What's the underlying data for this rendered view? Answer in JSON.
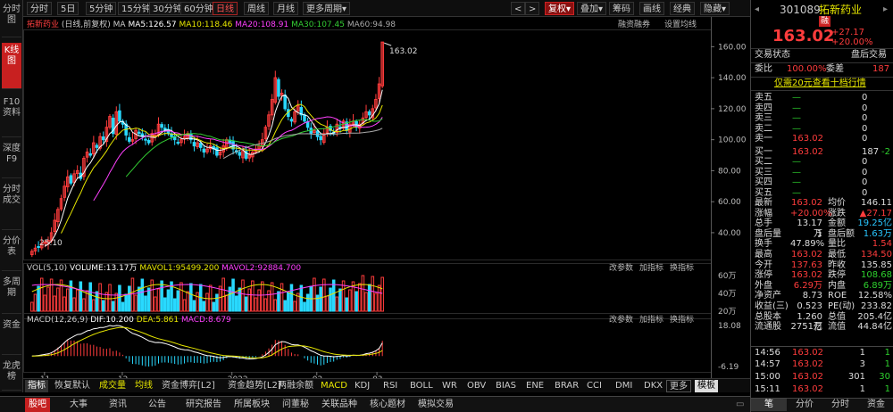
{
  "left_nav": [
    "分时图",
    "K线图",
    "F10资料",
    "深度F9",
    "分时成交",
    "分价表",
    "多周期",
    "资金",
    "龙虎榜"
  ],
  "left_nav_active": 1,
  "toolbar": {
    "periods": [
      "分时",
      "5日",
      "5分钟",
      "15分钟",
      "30分钟",
      "60分钟",
      "日线",
      "周线",
      "月线",
      "更多周期"
    ],
    "active_period": "日线",
    "right": [
      "复权",
      "叠加",
      "筹码",
      "画线",
      "经典",
      "隐藏"
    ],
    "dropdown_mark": "▾",
    "nav_arrows": [
      "<",
      ">"
    ]
  },
  "chart": {
    "stock_name": "拓新药业",
    "mode": "(日线,前复权)",
    "ma_label": "MA",
    "ma": [
      {
        "label": "MA5:126.57",
        "color": "#ffffff"
      },
      {
        "label": "MA10:118.46",
        "color": "#e6e600"
      },
      {
        "label": "MA20:108.91",
        "color": "#ff40ff"
      },
      {
        "label": "MA30:107.45",
        "color": "#33cc33"
      },
      {
        "label": "MA60:94.98",
        "color": "#aaaaaa"
      }
    ],
    "top_right": [
      "融资融券",
      "设置均线"
    ],
    "high_label": "163.02",
    "low_label": "25.10",
    "price_ticks": [
      "160.00",
      "140.00",
      "120.00",
      "100.00",
      "80.00",
      "60.00",
      "40.00"
    ],
    "date_ticks": [
      "11",
      "12",
      "2022",
      "02",
      "03"
    ],
    "vol_legend": {
      "name": "VOL(5,10)",
      "vol": "VOLUME:13.17万",
      "mavol1": "MAVOL1:95499.200",
      "mavol2": "MAVOL2:92884.700"
    },
    "vol_ticks": [
      "60万",
      "40万",
      "20万"
    ],
    "macd_legend": {
      "name": "MACD(12,26,9)",
      "dif": "DIF:10.200",
      "dea": "DEA:5.861",
      "macd": "MACD:8.679"
    },
    "macd_ticks": [
      "18.08",
      "-6.19"
    ],
    "panel_buttons": [
      "改参数",
      "加指标",
      "换指标"
    ],
    "colors": {
      "up": "#ff3c3c",
      "down": "#29d9ff",
      "ma5": "#ffffff",
      "ma10": "#e6e600",
      "ma20": "#ff40ff",
      "ma30": "#33cc33",
      "ma60": "#aaaaaa"
    }
  },
  "chart_data": {
    "type": "candlestick",
    "ylim": [
      25,
      170
    ],
    "dates": [
      "11",
      "12",
      "2022",
      "02",
      "03"
    ],
    "close": [
      28,
      30,
      31,
      33,
      34,
      35,
      40,
      48,
      55,
      62,
      70,
      76,
      72,
      78,
      80,
      75,
      88,
      92,
      90,
      98,
      95,
      102,
      100,
      108,
      115,
      104,
      118,
      112,
      110,
      103,
      99,
      100,
      106,
      104,
      102,
      100,
      98,
      104,
      103,
      110,
      108,
      106,
      104,
      102,
      100,
      98,
      100,
      102,
      104,
      100,
      96,
      98,
      95,
      92,
      94,
      96,
      94,
      90,
      92,
      96,
      100,
      98,
      94,
      92,
      90,
      93,
      88,
      90,
      92,
      94,
      96,
      100,
      108,
      116,
      126,
      140,
      128,
      130,
      120,
      115,
      112,
      118,
      122,
      116,
      112,
      108,
      104,
      106,
      102,
      100,
      104,
      108,
      106,
      104,
      110,
      108,
      112,
      106,
      110,
      112,
      108,
      110,
      114,
      118,
      116,
      120,
      126,
      136,
      163.02
    ],
    "volume_scale_max": "60万",
    "macd_range": [
      -6.19,
      18.08
    ]
  },
  "right_panel": {
    "code": "301089",
    "name": "拓新药业",
    "tag": "融",
    "price": "163.02",
    "change": "+27.17",
    "change_pct": "+20.00%",
    "status_label": "交易状态",
    "status_value": "盘后交易",
    "weibi_label": "委比",
    "weibi": "100.00%",
    "weicha_label": "委差",
    "weicha": "187",
    "promo": "仅需20元查看十档行情",
    "sells": [
      {
        "label": "卖五",
        "price": "—",
        "vol": "0"
      },
      {
        "label": "卖四",
        "price": "—",
        "vol": "0"
      },
      {
        "label": "卖三",
        "price": "—",
        "vol": "0"
      },
      {
        "label": "卖二",
        "price": "—",
        "vol": "0"
      },
      {
        "label": "卖一",
        "price": "163.02",
        "vol": "0"
      }
    ],
    "buys": [
      {
        "label": "买一",
        "price": "163.02",
        "vol": "187",
        "delta": "-2"
      },
      {
        "label": "买二",
        "price": "—",
        "vol": "0",
        "delta": ""
      },
      {
        "label": "买三",
        "price": "—",
        "vol": "0",
        "delta": ""
      },
      {
        "label": "买四",
        "price": "—",
        "vol": "0",
        "delta": ""
      },
      {
        "label": "买五",
        "price": "—",
        "vol": "0",
        "delta": ""
      }
    ],
    "stats": [
      [
        "最新",
        "163.02",
        "均价",
        "146.11"
      ],
      [
        "涨幅",
        "+20.00%",
        "涨跌",
        "▲27.17"
      ],
      [
        "总手",
        "13.17万",
        "金额",
        "19.25亿"
      ],
      [
        "盘后量",
        "1",
        "盘后额",
        "1.63万"
      ],
      [
        "换手",
        "47.89%",
        "量比",
        "1.54"
      ],
      [
        "最高",
        "163.02",
        "最低",
        "134.50"
      ],
      [
        "今开",
        "137.63",
        "昨收",
        "135.85"
      ],
      [
        "涨停",
        "163.02",
        "跌停",
        "108.68"
      ],
      [
        "外盘",
        "6.29万",
        "内盘",
        "6.89万"
      ],
      [
        "净资产",
        "8.73",
        "ROE",
        "12.58%"
      ],
      [
        "收益(三)",
        "0.523",
        "PE(动)",
        "233.82"
      ],
      [
        "总股本",
        "1.260亿",
        "总值",
        "205.4亿"
      ],
      [
        "流通股",
        "2751万",
        "流值",
        "44.84亿"
      ]
    ],
    "ticks": [
      {
        "time": "14:56",
        "price": "163.02",
        "vol": "1",
        "n": "1"
      },
      {
        "time": "14:57",
        "price": "163.02",
        "vol": "3",
        "n": "1"
      },
      {
        "time": "15:00",
        "price": "163.02",
        "vol": "301",
        "n": "30"
      },
      {
        "time": "15:11",
        "price": "163.02",
        "vol": "1",
        "n": "1"
      }
    ],
    "bottom_tabs": [
      "笔",
      "分价",
      "分时",
      "资金"
    ]
  },
  "indicator_tabs": [
    "指标",
    "恢复默认",
    "成交量",
    "均线",
    "资金博弈[L2]",
    "资金趋势[L2]",
    "两融余额",
    "MACD",
    "KDJ",
    "RSI",
    "BOLL",
    "WR",
    "OBV",
    "BIAS",
    "ENE",
    "BRAR",
    "CCI",
    "DMI",
    "DKX",
    "更多",
    "模板"
  ],
  "bottom_bar": [
    "股吧",
    "大事",
    "资讯",
    "公告",
    "研究报告",
    "所属板块",
    "问董秘",
    "关联品种",
    "核心题材",
    "模拟交易"
  ]
}
